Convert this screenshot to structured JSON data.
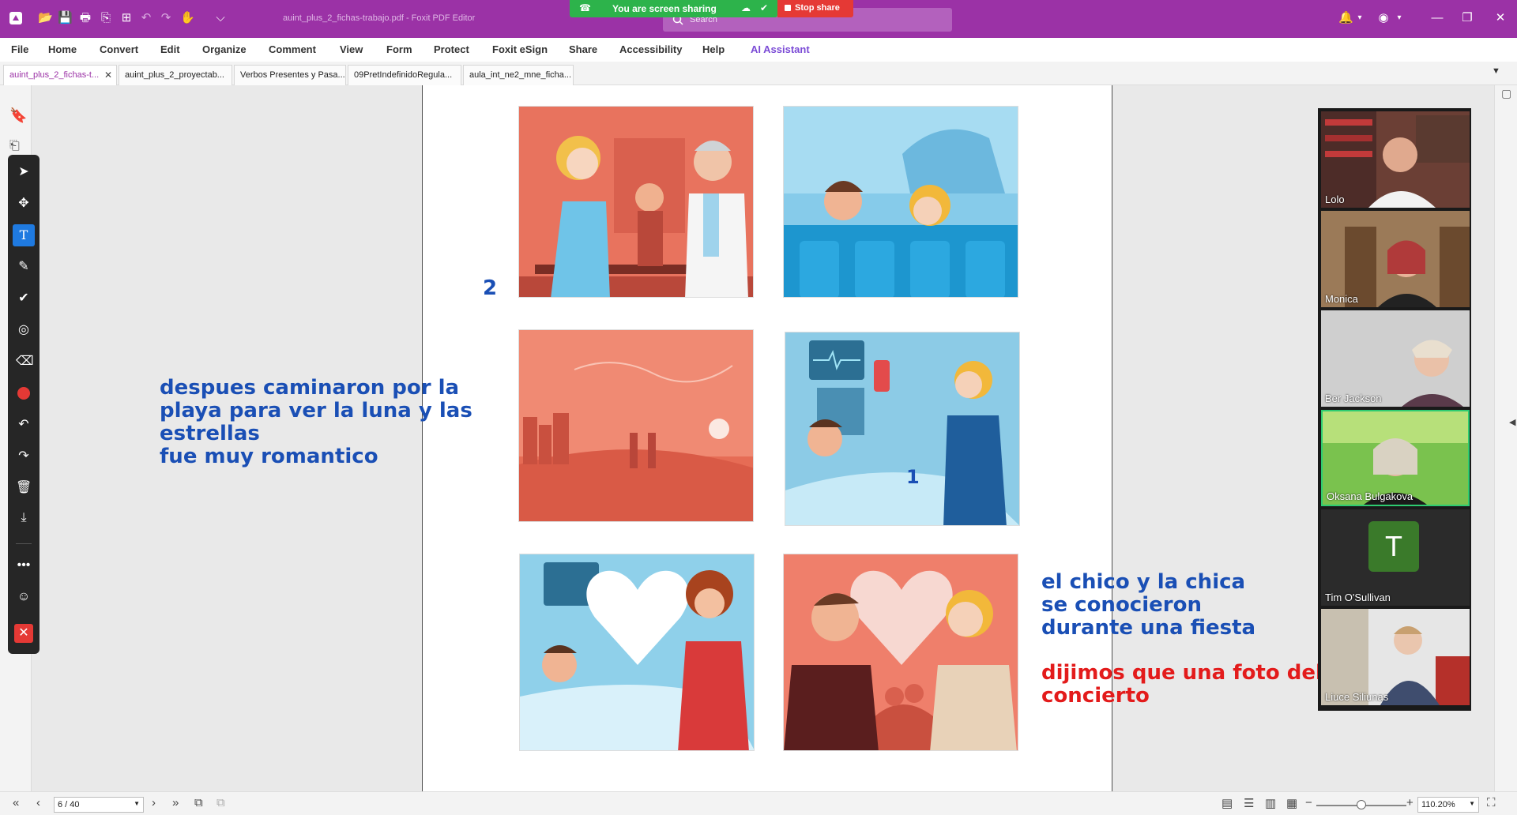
{
  "app": {
    "doc_title": "auint_plus_2_fichas-trabajo.pdf - Foxit PDF Editor",
    "search_placeholder": "Search"
  },
  "screenshare": {
    "status": "You are screen sharing",
    "stop_label": "Stop share"
  },
  "menu": [
    "File",
    "Home",
    "Convert",
    "Edit",
    "Organize",
    "Comment",
    "View",
    "Form",
    "Protect",
    "Foxit eSign",
    "Share",
    "Accessibility",
    "Help",
    "AI Assistant"
  ],
  "tabs": [
    {
      "label": "auint_plus_2_fichas-t...",
      "active": true
    },
    {
      "label": "auint_plus_2_proyectab..."
    },
    {
      "label": "Verbos Presentes y Pasa..."
    },
    {
      "label": "09PretIndefinidoRegula..."
    },
    {
      "label": "aula_int_ne2_mne_ficha..."
    }
  ],
  "page": {
    "number_2": "2",
    "number_1": "1"
  },
  "annotations": {
    "left": "despues caminaron por la\nplaya para ver la luna y las\nestrellas\nfue muy romantico",
    "right_blue": "el chico y la chica\nse conocieron\ndurante una fiesta",
    "right_red": "dijimos que una foto del\nconcierto"
  },
  "participants": [
    {
      "name": "Lolo"
    },
    {
      "name": "Monica"
    },
    {
      "name": "Ber Jackson"
    },
    {
      "name": "Oksana Bulgakova",
      "speaking": true
    },
    {
      "name": "Tim O'Sullivan",
      "initial": "T"
    },
    {
      "name": "Liuce Siliunas"
    }
  ],
  "navigation": {
    "page_value": "6 / 40",
    "zoom_value": "110.20%",
    "zoom_level_percent": 110.2
  },
  "colors": {
    "titlebar": "#9b32a6",
    "share_green": "#2db34b",
    "stop_red": "#e53935",
    "annotation_blue": "#1a4fb5",
    "annotation_red": "#e31b1b",
    "ai_purple": "#7b4bd6"
  }
}
